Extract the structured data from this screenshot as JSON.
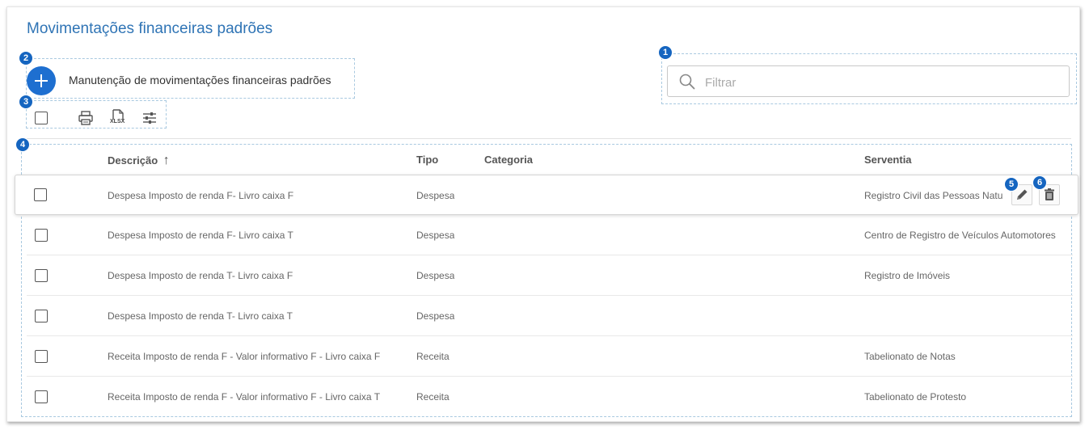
{
  "page": {
    "title": "Movimentações financeiras padrões"
  },
  "add": {
    "label": "Manutenção de movimentações financeiras padrões"
  },
  "search": {
    "placeholder": "Filtrar",
    "value": ""
  },
  "toolbar": {
    "xlsx_label": "XLSX"
  },
  "badges": [
    "1",
    "2",
    "3",
    "4",
    "5",
    "6"
  ],
  "table": {
    "columns": {
      "descricao": "Descrição",
      "tipo": "Tipo",
      "categoria": "Categoria",
      "serventia": "Serventia"
    },
    "sort_indicator": "↑",
    "rows": [
      {
        "descricao": "Despesa Imposto de renda F- Livro caixa F",
        "tipo": "Despesa",
        "categoria": "",
        "serventia": "Registro Civil das Pessoas Natu"
      },
      {
        "descricao": "Despesa Imposto de renda F- Livro caixa T",
        "tipo": "Despesa",
        "categoria": "",
        "serventia": "Centro de Registro de Veículos Automotores"
      },
      {
        "descricao": "Despesa Imposto de renda T- Livro caixa F",
        "tipo": "Despesa",
        "categoria": "",
        "serventia": "Registro de Imóveis"
      },
      {
        "descricao": "Despesa Imposto de renda T- Livro caixa T",
        "tipo": "Despesa",
        "categoria": "",
        "serventia": ""
      },
      {
        "descricao": "Receita Imposto de renda F - Valor informativo F - Livro caixa F",
        "tipo": "Receita",
        "categoria": "",
        "serventia": "Tabelionato de Notas"
      },
      {
        "descricao": "Receita Imposto de renda F - Valor informativo F - Livro caixa T",
        "tipo": "Receita",
        "categoria": "",
        "serventia": "Tabelionato de Protesto"
      }
    ]
  },
  "icons": {
    "add": "plus-icon",
    "search": "search-icon",
    "print": "printer-icon",
    "export": "xlsx-export-icon",
    "columns": "sliders-icon",
    "edit": "pencil-icon",
    "delete": "trash-icon",
    "sort": "arrow-up-icon"
  },
  "colors": {
    "accent": "#1e6fd0",
    "title": "#2f74b5",
    "badge": "#1565c0"
  }
}
